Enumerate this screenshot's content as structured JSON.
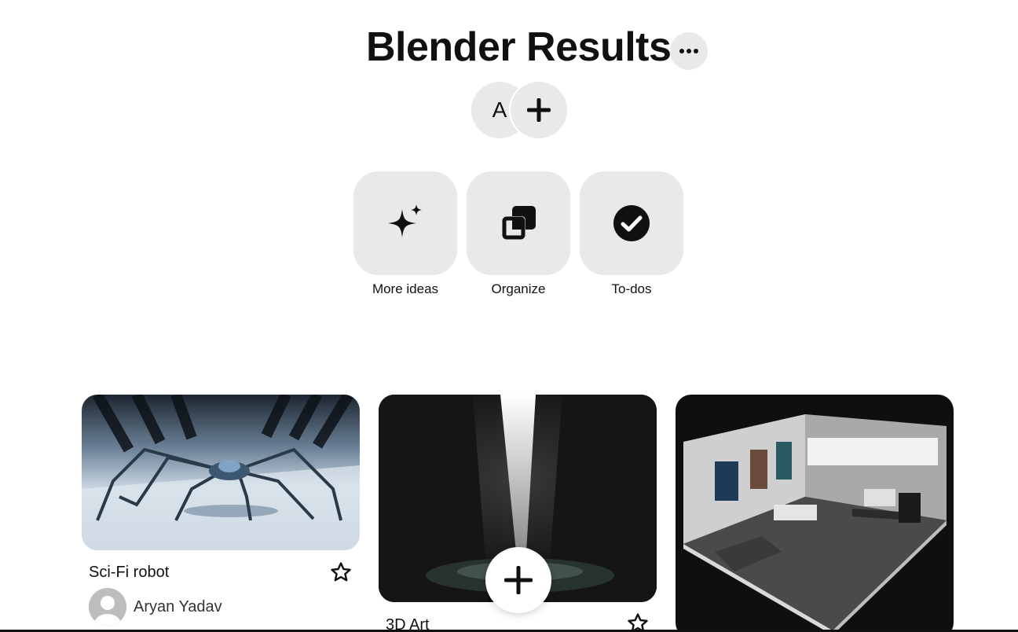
{
  "board": {
    "title": "Blender Results",
    "collaborator_initial": "A"
  },
  "icons": {
    "more": "ellipsis-icon",
    "add_collaborator": "plus-icon",
    "more_ideas": "sparkle-icon",
    "organize": "stacked-squares-icon",
    "todos": "check-circle-icon",
    "save": "star-icon",
    "create": "plus-icon"
  },
  "actions": [
    {
      "label": "More ideas"
    },
    {
      "label": "Organize"
    },
    {
      "label": "To-dos"
    }
  ],
  "pins": [
    {
      "title": "Sci-Fi robot",
      "author": "Aryan Yadav"
    },
    {
      "title": "3D Art"
    },
    {
      "title": ""
    }
  ],
  "colors": {
    "tile_bg": "#e9e9e9",
    "text": "#111111"
  }
}
